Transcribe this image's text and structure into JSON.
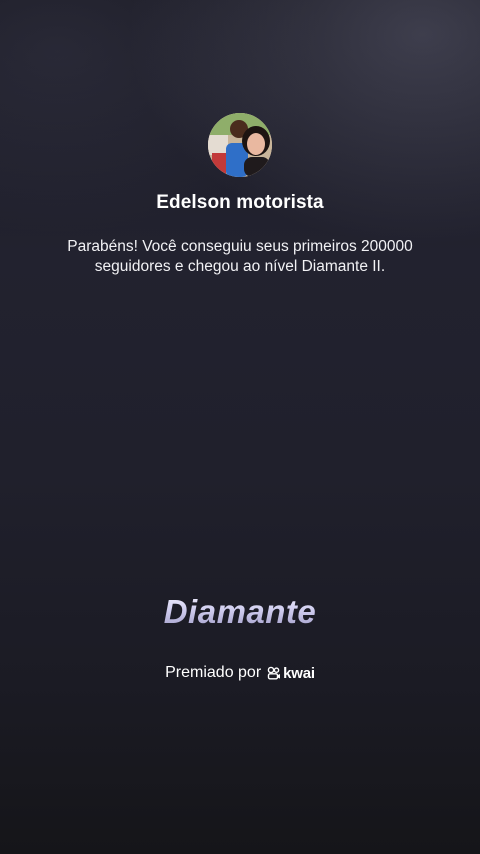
{
  "profile": {
    "avatar_icon": "profile-photo-icon",
    "name": "Edelson motorista"
  },
  "message": "Parabéns! Você conseguiu seus primeiros 200000 seguidores e chegou ao nível Diamante II.",
  "level": {
    "title": "Diamante"
  },
  "award": {
    "prefix": "Premiado por",
    "brand_icon": "kwai-logo-icon",
    "brand_name": "kwai"
  },
  "colors": {
    "background_top": "#1b1b25",
    "background_bottom": "#151519",
    "level_title_light": "#f3f2ff",
    "level_title_dark": "#9f9bc6",
    "text": "#ffffff"
  }
}
